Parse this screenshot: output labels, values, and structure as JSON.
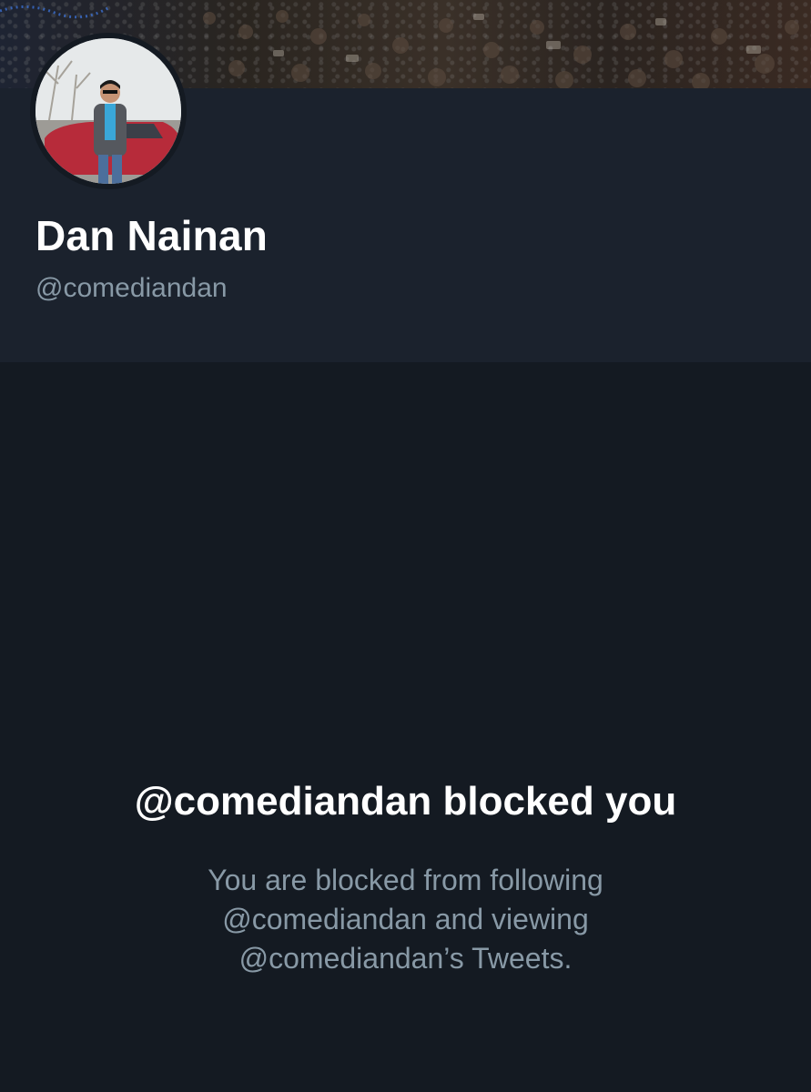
{
  "profile": {
    "display_name": "Dan Nainan",
    "handle": "@comediandan"
  },
  "blocked": {
    "title": "@comediandan blocked you",
    "description": "You are blocked from following @comediandan and viewing @comediandan’s Tweets."
  },
  "colors": {
    "background": "#141a22",
    "header_panel": "#1b222d",
    "primary_text": "#ffffff",
    "secondary_text": "#8899a6"
  }
}
